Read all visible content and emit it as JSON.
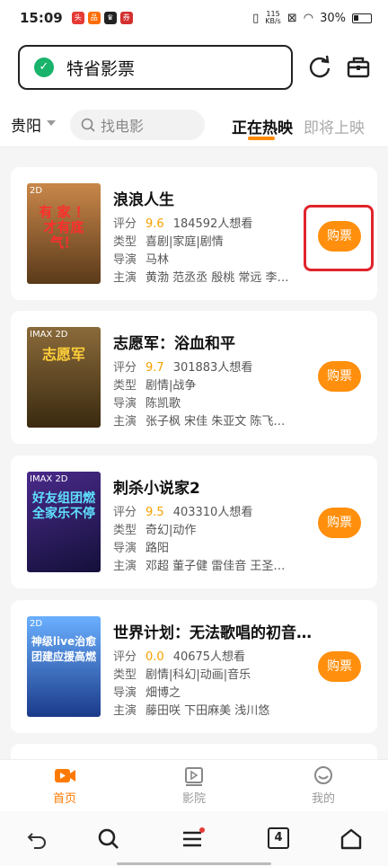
{
  "status_bar": {
    "time": "15:09",
    "net_speed_value": "115",
    "net_speed_unit": "KB/s",
    "battery": "30%"
  },
  "header": {
    "promo_label": "特省影票"
  },
  "filters": {
    "city": "贵阳",
    "search_placeholder": "找电影",
    "tab_now": "正在热映",
    "tab_upcoming": "即将上映"
  },
  "labels": {
    "score": "评分",
    "type": "类型",
    "director": "导演",
    "cast": "主演",
    "buy": "购票"
  },
  "movies": [
    {
      "title": "浪浪人生",
      "format": "2D",
      "score": "9.6",
      "want": "184592人想看",
      "genre": "喜剧|家庭|剧情",
      "director": "马林",
      "cast": "黄渤 范丞丞 殷桃 常远 李…",
      "poster_text": "有 家 ！ 才有底气！",
      "poster_color": "#8a5a2c"
    },
    {
      "title": "志愿军：浴血和平",
      "format": "IMAX 2D",
      "score": "9.7",
      "want": "301883人想看",
      "genre": "剧情|战争",
      "director": "陈凯歌",
      "cast": "张子枫 宋佳 朱亚文 陈飞…",
      "poster_text": "志愿军",
      "poster_color": "#6b4a1e"
    },
    {
      "title": "刺杀小说家2",
      "format": "IMAX 2D",
      "score": "9.5",
      "want": "403310人想看",
      "genre": "奇幻|动作",
      "director": "路阳",
      "cast": "邓超 董子健 雷佳音 王圣…",
      "poster_text": "好友组团燃 全家乐不停",
      "poster_color": "#2a1a4e"
    },
    {
      "title": "世界计划：无法歌唱的初音…",
      "format": "2D",
      "score": "0.0",
      "want": "40675人想看",
      "genre": "剧情|科幻|动画|音乐",
      "director": "畑博之",
      "cast": "藤田咲 下田麻美 浅川悠",
      "poster_text": "神级live治愈 团建应援高燃",
      "poster_color": "#3a6fd8"
    }
  ],
  "bottom_nav": {
    "home": "首页",
    "cinema": "影院",
    "mine": "我的"
  },
  "system_nav": {
    "tabs_count": "4"
  },
  "colors": {
    "accent": "#ff8f0c",
    "score": "#f5a100",
    "highlight": "#e0242b"
  }
}
